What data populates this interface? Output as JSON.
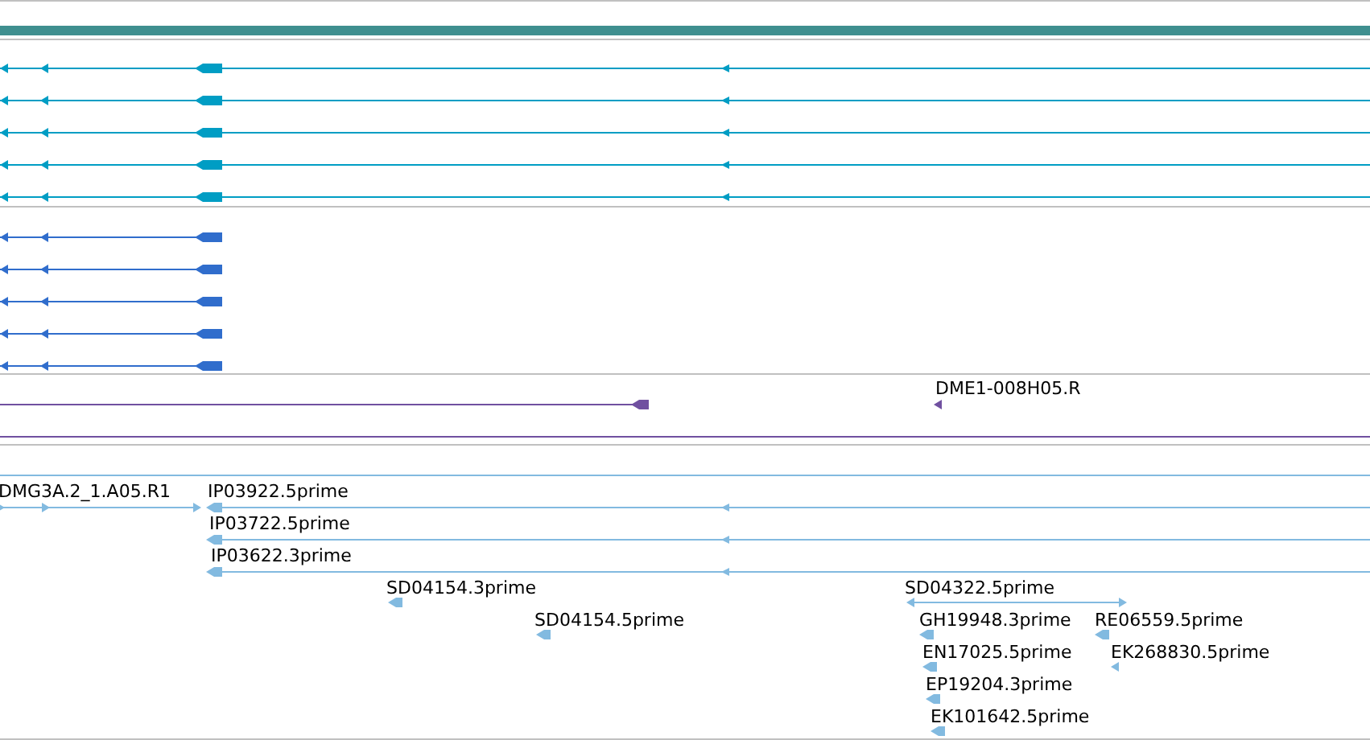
{
  "scale_bar": {
    "color": "#3f8f8f"
  },
  "tracks": [
    {
      "kind": "transcripts",
      "color": "#009dc4"
    },
    {
      "kind": "genes",
      "color": "#306dcc"
    },
    {
      "kind": "clones",
      "color": "#7050a0",
      "features": [
        {
          "label": "DME1-008H05.R"
        }
      ]
    },
    {
      "kind": "ests",
      "color": "#82bae0",
      "features": [
        {
          "label": "DMG3A.2_1.A05.R1"
        },
        {
          "label": "IP03922.5prime"
        },
        {
          "label": "IP03722.5prime"
        },
        {
          "label": "IP03622.3prime"
        },
        {
          "label": "SD04154.3prime"
        },
        {
          "label": "SD04154.5prime"
        },
        {
          "label": "SD04322.5prime"
        },
        {
          "label": "GH19948.3prime"
        },
        {
          "label": "RE06559.5prime"
        },
        {
          "label": "EN17025.5prime"
        },
        {
          "label": "EK268830.5prime"
        },
        {
          "label": "EP19204.3prime"
        },
        {
          "label": "EK101642.5prime"
        }
      ]
    }
  ]
}
